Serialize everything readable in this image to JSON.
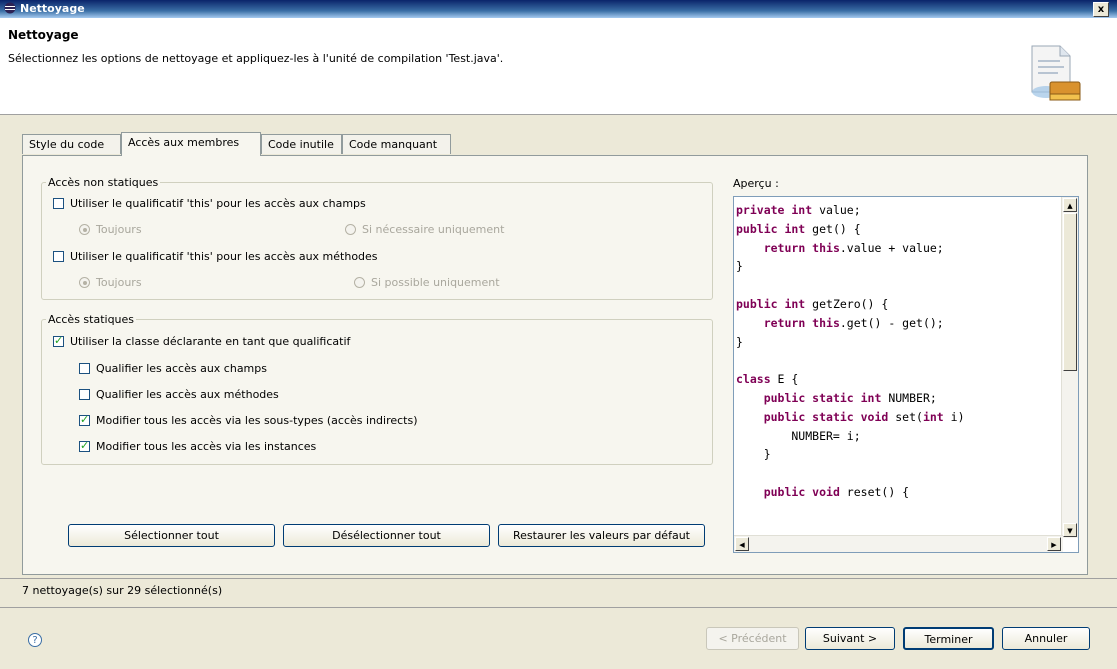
{
  "window": {
    "title": "Nettoyage",
    "close_label": "x"
  },
  "header": {
    "title": "Nettoyage",
    "description": "Sélectionnez les options de nettoyage et appliquez-les à l'unité de compilation 'Test.java'."
  },
  "tabs": [
    {
      "label": "Style du code",
      "active": false
    },
    {
      "label": "Accès aux membres",
      "active": true
    },
    {
      "label": "Code inutile",
      "active": false
    },
    {
      "label": "Code manquant",
      "active": false
    }
  ],
  "non_static": {
    "legend": "Accès non statiques",
    "fields_checkbox": {
      "label": "Utiliser le qualificatif 'this' pour les accès aux champs",
      "checked": false
    },
    "fields_always": {
      "label": "Toujours",
      "selected": true
    },
    "fields_necessary": {
      "label": "Si nécessaire uniquement",
      "selected": false
    },
    "methods_checkbox": {
      "label": "Utiliser le qualificatif 'this' pour les accès aux méthodes",
      "checked": false
    },
    "methods_always": {
      "label": "Toujours",
      "selected": true
    },
    "methods_possible": {
      "label": "Si possible uniquement",
      "selected": false
    }
  },
  "static": {
    "legend": "Accès statiques",
    "use_declaring_class": {
      "label": "Utiliser la classe déclarante en tant que qualificatif",
      "checked": true
    },
    "qualify_fields": {
      "label": "Qualifier les accès aux champs",
      "checked": false
    },
    "qualify_methods": {
      "label": "Qualifier les accès aux méthodes",
      "checked": false
    },
    "via_subtypes": {
      "label": "Modifier tous les accès via les sous-types (accès indirects)",
      "checked": true
    },
    "via_instances": {
      "label": "Modifier tous les accès via les instances",
      "checked": true
    }
  },
  "actions": {
    "select_all": "Sélectionner tout",
    "deselect_all": "Désélectionner tout",
    "restore_defaults": "Restaurer les valeurs par défaut"
  },
  "preview": {
    "label": "Aperçu :",
    "lines": [
      "private int value;",
      "public int get() {",
      "    return this.value + value;",
      "}",
      "",
      "public int getZero() {",
      "    return this.get() - get();",
      "}",
      "",
      "class E {",
      "    public static int NUMBER;",
      "    public static void set(int i)",
      "        NUMBER= i;",
      "    }",
      "",
      "    public void reset() {"
    ]
  },
  "status": {
    "summary": "7 nettoyage(s) sur 29 sélectionné(s)"
  },
  "footer": {
    "help_icon": "question-icon",
    "back": "< Précédent",
    "next": "Suivant >",
    "finish": "Terminer",
    "cancel": "Annuler"
  },
  "colors": {
    "title_gradient_start": "#0a246a",
    "keyword": "#7f0055",
    "check": "#21a121"
  }
}
